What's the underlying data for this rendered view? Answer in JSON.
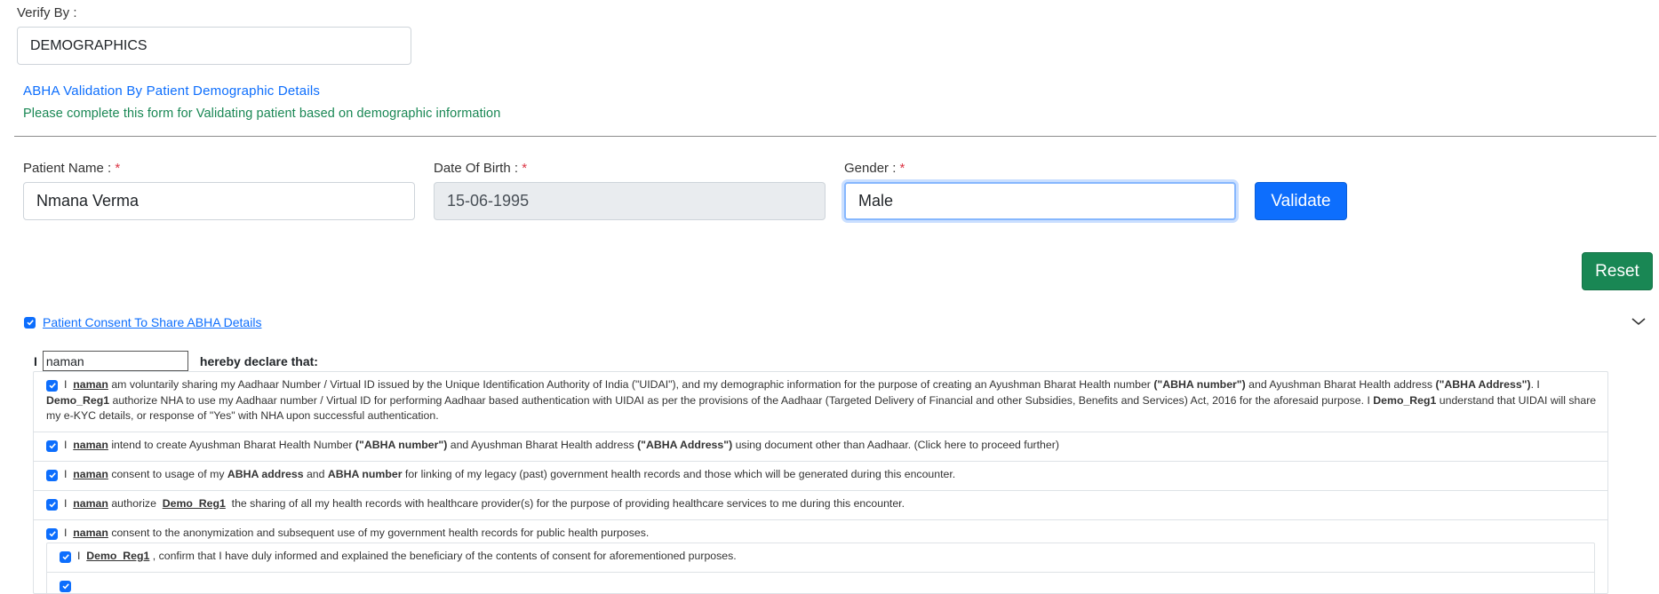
{
  "verify_by": {
    "label": "Verify By :",
    "value": "DEMOGRAPHICS"
  },
  "section": {
    "title": "ABHA Validation By Patient Demographic Details",
    "subtitle": "Please complete this form for Validating patient based on demographic information"
  },
  "form": {
    "patient_name": {
      "label": "Patient Name : ",
      "required": "*",
      "value": "Nmana Verma"
    },
    "dob": {
      "label": "Date Of Birth : ",
      "required": "*",
      "value": "15-06-1995"
    },
    "gender": {
      "label": "Gender : ",
      "required": "*",
      "value": "Male"
    },
    "validate_label": "Validate",
    "reset_label": "Reset"
  },
  "consent": {
    "header_label": "Patient Consent To Share ABHA Details",
    "declare_prefix": "I",
    "declare_name": "naman",
    "declare_suffix": "hereby declare that:",
    "items": [
      {
        "i": "I",
        "name": "naman",
        "t1": " am voluntarily sharing my Aadhaar Number / Virtual ID issued by the Unique Identification Authority of India (\"UIDAI\"), and my demographic information for the purpose of creating an Ayushman Bharat Health number ",
        "b1": "(\"ABHA number\")",
        "t2": " and Ayushman Bharat Health address ",
        "b2": "(\"ABHA Address\")",
        "t3": ". I ",
        "b3": "Demo_Reg1",
        "t4": " authorize NHA to use my Aadhaar number / Virtual ID for performing Aadhaar based authentication with UIDAI as per the provisions of the Aadhaar (Targeted Delivery of Financial and other Subsidies, Benefits and Services) Act, 2016 for the aforesaid purpose. I ",
        "b4": "Demo_Reg1",
        "t5": " understand that UIDAI will share my e-KYC details, or response of \"Yes\" with NHA upon successful authentication."
      },
      {
        "i": "I",
        "name": "naman",
        "t1": " intend to create Ayushman Bharat Health Number ",
        "b1": "(\"ABHA number\")",
        "t2": " and Ayushman Bharat Health address ",
        "b2": "(\"ABHA Address\")",
        "t3": " using document other than Aadhaar. (Click here to proceed further)"
      },
      {
        "i": "I",
        "name": "naman",
        "t1": " consent to usage of my ",
        "b1": "ABHA address",
        "t2": " and ",
        "b2": "ABHA number",
        "t3": " for linking of my legacy (past) government health records and those which will be generated during this encounter."
      },
      {
        "i": "I",
        "name": "naman",
        "t1": " authorize ",
        "name2": "Demo_Reg1",
        "t2": " the sharing of all my health records with healthcare provider(s) for the purpose of providing healthcare services to me during this encounter."
      },
      {
        "i": "I",
        "name": "naman",
        "t1": " consent to the anonymization and subsequent use of my government health records for public health purposes."
      }
    ],
    "sub_item": {
      "i": "I",
      "name": "Demo_Reg1",
      "t1": " , confirm that I have duly informed and explained the beneficiary of the contents of consent for aforementioned purposes."
    }
  },
  "colors": {
    "primary": "#0d6efd",
    "success": "#198754",
    "section_title": "#0d6efd",
    "section_subtitle": "#198754",
    "required": "#dc3545"
  },
  "icons": {
    "consent_checkbox": "checkbox-checked-icon",
    "collapse": "chevron-down-icon"
  }
}
